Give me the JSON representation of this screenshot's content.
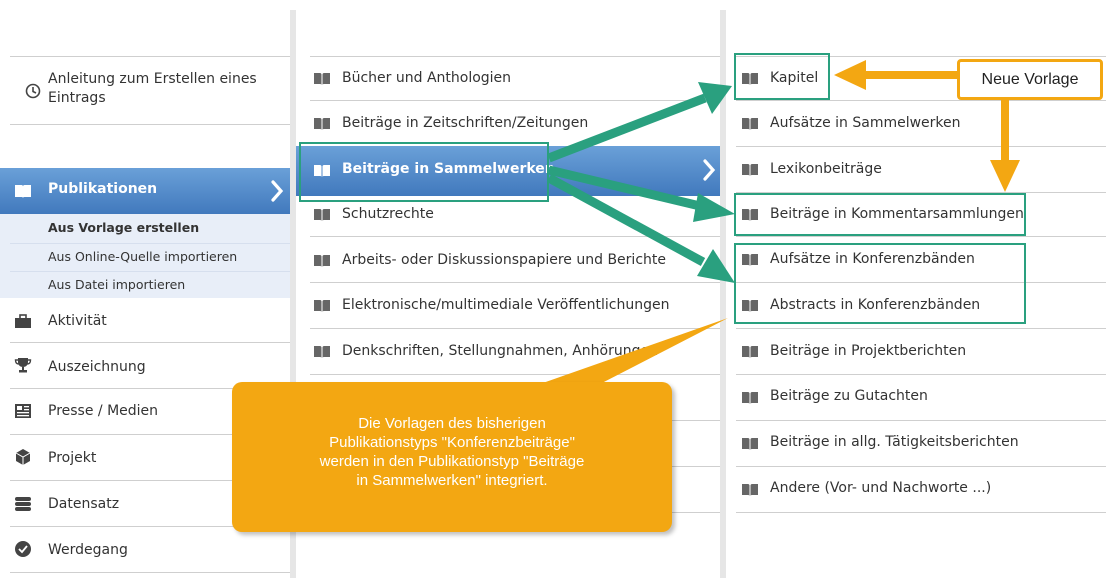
{
  "sidebar": {
    "guide_label_line1": "Anleitung zum Erstellen eines",
    "guide_label_line2": "Eintrags",
    "publications_label": "Publikationen",
    "publications_sub": [
      {
        "label": "Aus Vorlage erstellen"
      },
      {
        "label": "Aus Online-Quelle importieren"
      },
      {
        "label": "Aus Datei importieren"
      }
    ],
    "items": [
      {
        "label": "Aktivität",
        "icon": "briefcase-icon"
      },
      {
        "label": "Auszeichnung",
        "icon": "trophy-icon"
      },
      {
        "label": "Presse / Medien",
        "icon": "newspaper-icon"
      },
      {
        "label": "Projekt",
        "icon": "cube-icon"
      },
      {
        "label": "Datensatz",
        "icon": "database-icon"
      },
      {
        "label": "Werdegang",
        "icon": "career-icon"
      }
    ]
  },
  "types": {
    "items": [
      {
        "label": "Bücher und Anthologien"
      },
      {
        "label": "Beiträge in Zeitschriften/Zeitungen"
      },
      {
        "label": "Beiträge in Sammelwerken"
      },
      {
        "label": "Schutzrechte"
      },
      {
        "label": "Arbeits- oder Diskussionspapiere und Berichte"
      },
      {
        "label": "Elektronische/multimediale Veröffentlichungen"
      },
      {
        "label": "Denkschriften, Stellungnahmen, Anhörungen"
      }
    ]
  },
  "templates": {
    "items": [
      {
        "label": "Kapitel"
      },
      {
        "label": "Aufsätze in Sammelwerken"
      },
      {
        "label": "Lexikonbeiträge"
      },
      {
        "label": "Beiträge in Kommentarsammlungen"
      },
      {
        "label": "Aufsätze in Konferenzbänden"
      },
      {
        "label": "Abstracts in Konferenzbänden"
      },
      {
        "label": "Beiträge in Projektberichten"
      },
      {
        "label": "Beiträge zu Gutachten"
      },
      {
        "label": "Beiträge in allg. Tätigkeitsberichten"
      },
      {
        "label": "Andere (Vor- und Nachworte ...)"
      }
    ]
  },
  "annotations": {
    "new_template": "Neue Vorlage",
    "callout_line1": "Die Vorlagen des bisherigen",
    "callout_line2": "Publikationstyps \"Konferenzbeiträge\"",
    "callout_line3": "werden in den Publikationstyp \"Beiträge",
    "callout_line4": "in  Sammelwerken\" integriert."
  },
  "colors": {
    "highlight": "#4a82c4",
    "annotation_green": "#2aa07f",
    "annotation_orange": "#f3a712"
  }
}
